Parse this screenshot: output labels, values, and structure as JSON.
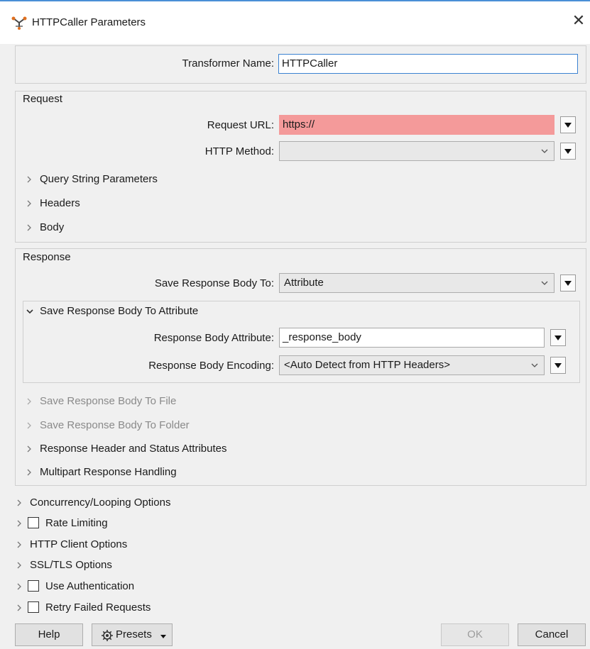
{
  "window": {
    "title": "HTTPCaller Parameters",
    "icon": "transformer-icon",
    "close_icon": "close-icon"
  },
  "transformer_name": {
    "label": "Transformer Name:",
    "value": "HTTPCaller"
  },
  "request": {
    "title": "Request",
    "url_label": "Request URL:",
    "url_value": "https://",
    "method_label": "HTTP Method:",
    "method_value": "",
    "expanders": [
      "Query String Parameters",
      "Headers",
      "Body"
    ]
  },
  "response": {
    "title": "Response",
    "save_to_label": "Save Response Body To:",
    "save_to_value": "Attribute",
    "attr_group_title": "Save Response Body To Attribute",
    "attr_label": "Response Body Attribute:",
    "attr_value": "_response_body",
    "encoding_label": "Response Body Encoding:",
    "encoding_value": "<Auto Detect from HTTP Headers>",
    "disabled_expanders": [
      "Save Response Body To File",
      "Save Response Body To Folder"
    ],
    "expanders": [
      "Response Header and Status Attributes",
      "Multipart Response Handling"
    ]
  },
  "options": [
    {
      "label": "Concurrency/Looping Options",
      "checkbox": false
    },
    {
      "label": "Rate Limiting",
      "checkbox": true,
      "checked": false
    },
    {
      "label": "HTTP Client Options",
      "checkbox": false
    },
    {
      "label": "SSL/TLS Options",
      "checkbox": false
    },
    {
      "label": "Use Authentication",
      "checkbox": true,
      "checked": false
    },
    {
      "label": "Retry Failed Requests",
      "checkbox": true,
      "checked": false
    }
  ],
  "footer": {
    "help": "Help",
    "presets": "Presets",
    "ok": "OK",
    "cancel": "Cancel"
  },
  "colors": {
    "error_fill": "#f49a9a",
    "error_fill_select": "#ec8a8a",
    "focus_border": "#3b82d1"
  }
}
